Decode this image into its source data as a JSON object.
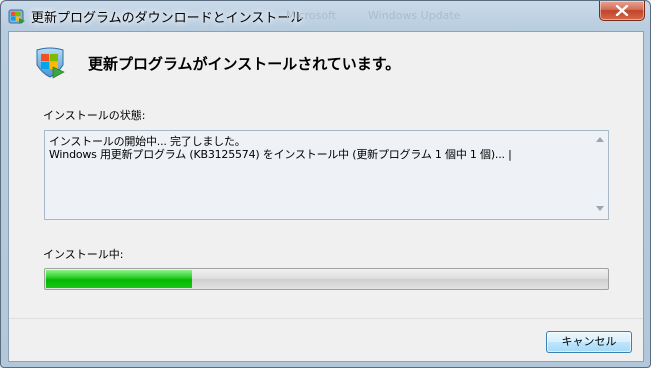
{
  "window": {
    "title": "更新プログラムのダウンロードとインストール",
    "background_ghost_texts": [
      "Microsoft",
      "Windows Update"
    ],
    "close_symbol": "✕"
  },
  "main": {
    "heading": "更新プログラムがインストールされています。",
    "status_label": "インストールの状態:",
    "log_lines": [
      "インストールの開始中... 完了しました。",
      "Windows 用更新プログラム (KB3125574) をインストール中 (更新プログラム 1 個中 1 個)... |"
    ],
    "progress_label": "インストール中:",
    "progress_fraction": 0.26,
    "cancel_label": "キャンセル"
  },
  "colors": {
    "progress_green": "#06b803",
    "close_red": "#c0442a",
    "button_border": "#3c7fb1"
  },
  "icons": {
    "title": "windows-update-icon",
    "header": "windows-update-icon",
    "close": "close-icon",
    "scroll_up": "scroll-up-arrow-icon",
    "scroll_down": "scroll-down-arrow-icon"
  }
}
